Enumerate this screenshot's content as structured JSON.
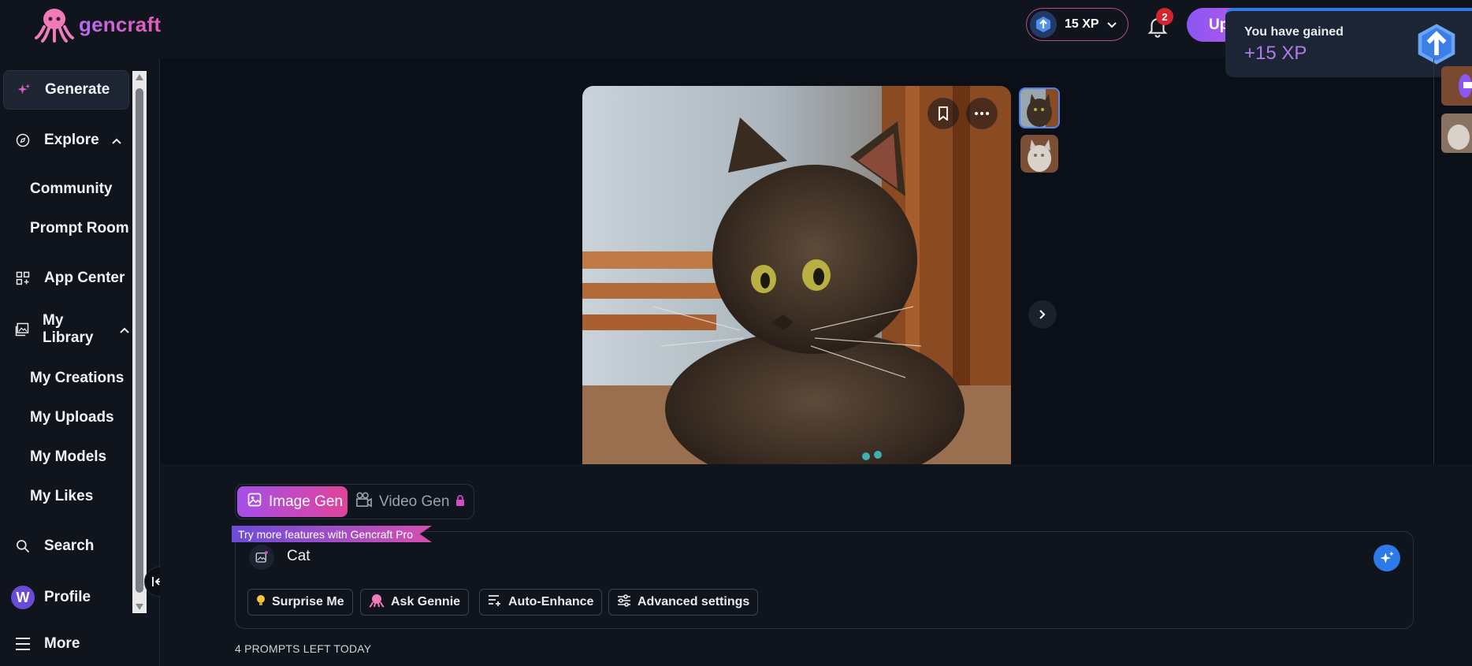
{
  "brand": {
    "name": "gencraft"
  },
  "header": {
    "xp_label": "15 XP",
    "notification_count": "2",
    "upgrade_label": "Up"
  },
  "toast": {
    "title": "You have gained",
    "xp": "+15 XP"
  },
  "sidebar": {
    "generate": "Generate",
    "explore": "Explore",
    "community": "Community",
    "prompt_room": "Prompt Room",
    "app_center": "App Center",
    "my_library": "My Library",
    "my_creations": "My Creations",
    "my_uploads": "My Uploads",
    "my_models": "My Models",
    "my_likes": "My Likes",
    "search": "Search",
    "profile": "Profile",
    "profile_initial": "W",
    "more": "More"
  },
  "composer": {
    "tab_image": "Image Gen",
    "tab_video": "Video Gen",
    "pro_banner": "Try more features with Gencraft Pro",
    "prompt_value": "Cat",
    "chips": {
      "surprise": "Surprise Me",
      "ask": "Ask Gennie",
      "enhance": "Auto-Enhance",
      "advanced": "Advanced settings"
    },
    "prompts_left": "4 PROMPTS LEFT TODAY"
  },
  "colors": {
    "accent_blue": "#2c7be8",
    "accent_pink": "#e0449a",
    "accent_purple": "#a54fe8"
  }
}
